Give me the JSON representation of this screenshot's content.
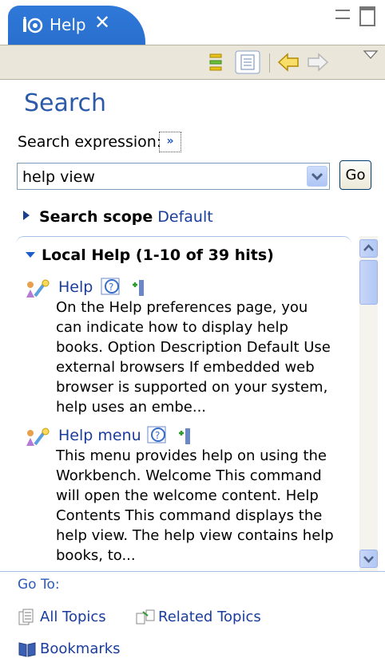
{
  "tab": {
    "title": "Help",
    "close_glyph": "✕"
  },
  "search": {
    "title": "Search",
    "expression_label": "Search expression:",
    "advanced_glyph": "»",
    "query_value": "help view",
    "go_label": "Go",
    "scope_label": "Search scope",
    "scope_value": "Default"
  },
  "results": {
    "header": "Local Help (1-10 of 39 hits)",
    "hits": [
      {
        "title": "Help",
        "lines": [
          "On the Help preferences page, you",
          "can indicate how to display help",
          "books. Option Description Default Use",
          "external browsers If embedded web",
          "browser is supported on your system,",
          "help uses an embe..."
        ]
      },
      {
        "title": "Help menu",
        "lines": [
          "This menu provides help on using the",
          "Workbench. Welcome This command",
          "will open the welcome content. Help",
          "Contents This command displays the",
          "help view. The help view contains help",
          "books, to..."
        ]
      }
    ]
  },
  "goto": {
    "label": "Go To:",
    "all_topics": "All Topics",
    "related_topics": "Related Topics",
    "bookmarks": "Bookmarks"
  },
  "colors": {
    "accent": "#2b5ba8",
    "link": "#1a3c9c",
    "tab": "#2f79d9"
  }
}
